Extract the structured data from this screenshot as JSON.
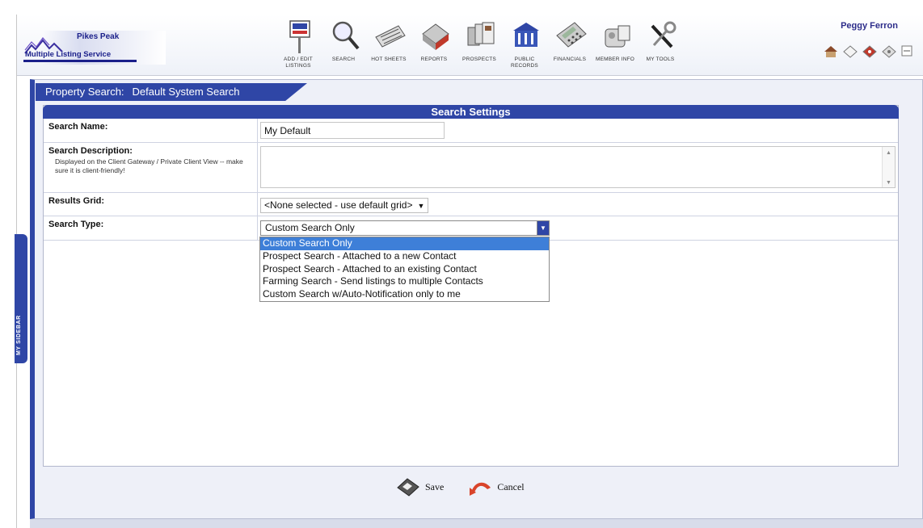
{
  "header": {
    "logo_title": "Pikes Peak",
    "logo_subtitle": "Multiple Listing Service",
    "user_name": "Peggy Ferron",
    "nav": [
      {
        "label": "ADD / EDIT LISTINGS",
        "icon": "add-edit-listings-icon"
      },
      {
        "label": "SEARCH",
        "icon": "magnifier-icon"
      },
      {
        "label": "HOT SHEETS",
        "icon": "hot-sheets-icon"
      },
      {
        "label": "REPORTS",
        "icon": "reports-icon"
      },
      {
        "label": "PROSPECTS",
        "icon": "prospects-icon"
      },
      {
        "label": "PUBLIC RECORDS",
        "icon": "public-records-icon"
      },
      {
        "label": "FINANCIALS",
        "icon": "calculator-icon"
      },
      {
        "label": "MEMBER INFO",
        "icon": "member-info-icon"
      },
      {
        "label": "MY TOOLS",
        "icon": "tools-icon"
      }
    ],
    "quick_icons": [
      "house-icon",
      "mail-icon",
      "tag-icon",
      "tag-alt-icon",
      "minimize-icon"
    ]
  },
  "sidebar": {
    "label": "MY SIDEBAR"
  },
  "page_tab": {
    "label": "Property Search:",
    "value": "Default System Search"
  },
  "settings": {
    "title": "Search Settings",
    "search_name": {
      "label": "Search Name:",
      "value": "My Default"
    },
    "search_description": {
      "label": "Search Description:",
      "help": "Displayed on the Client Gateway / Private Client View -- make sure it is client-friendly!",
      "value": ""
    },
    "results_grid": {
      "label": "Results Grid:",
      "value": "<None selected - use default grid>"
    },
    "search_type": {
      "label": "Search Type:",
      "value": "Custom Search Only",
      "options": [
        "Custom Search Only",
        "Prospect Search - Attached to a new Contact",
        "Prospect Search - Attached to an existing Contact",
        "Farming Search - Send listings to multiple Contacts",
        "Custom Search w/Auto-Notification only to me"
      ],
      "highlighted_index": 0
    }
  },
  "actions": {
    "save": "Save",
    "cancel": "Cancel"
  },
  "colors": {
    "brand_blue": "#2f46a6",
    "highlight": "#3e7fd8"
  }
}
